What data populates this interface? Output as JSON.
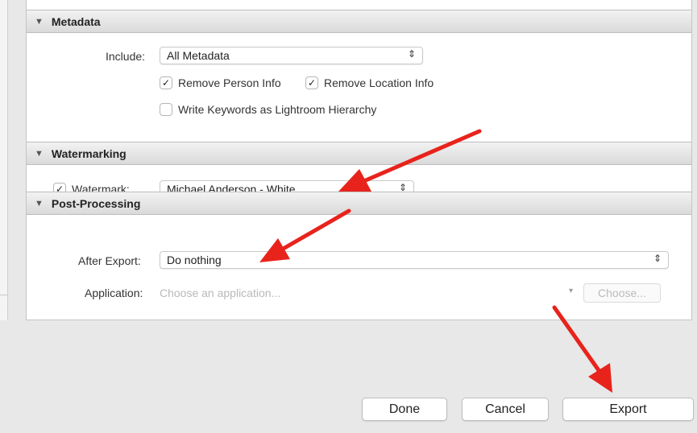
{
  "metadata": {
    "title": "Metadata",
    "include_label": "Include:",
    "include_value": "All Metadata",
    "remove_person": "Remove Person Info",
    "remove_location": "Remove Location Info",
    "write_keywords": "Write Keywords as Lightroom Hierarchy"
  },
  "watermarking": {
    "title": "Watermarking",
    "watermark_label": "Watermark:",
    "watermark_value": "Michael Anderson - White"
  },
  "post_processing": {
    "title": "Post-Processing",
    "after_export_label": "After Export:",
    "after_export_value": "Do nothing",
    "application_label": "Application:",
    "application_placeholder": "Choose an application...",
    "choose_label": "Choose..."
  },
  "footer": {
    "done": "Done",
    "cancel": "Cancel",
    "export": "Export"
  },
  "icons": {
    "triangle": "▼",
    "stepper": "⌃⌄",
    "checkmark": "✓",
    "caret": "▾"
  },
  "colors": {
    "annotation_arrow": "#e8231c"
  }
}
